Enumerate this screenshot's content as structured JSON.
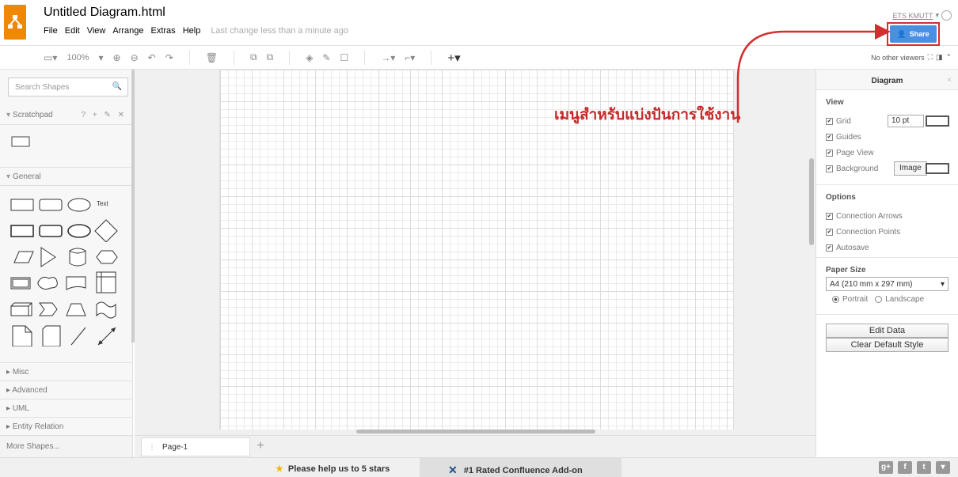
{
  "app": {
    "doc_title": "Untitled Diagram.html",
    "menu": [
      "File",
      "Edit",
      "View",
      "Arrange",
      "Extras",
      "Help"
    ],
    "last_change": "Last change less than a minute ago",
    "user_name": "ETS KMUTT",
    "share_label": "Share",
    "accent": "#4a90e2",
    "logo_color": "#f08705"
  },
  "toolbar": {
    "zoom": "100%",
    "viewers": "No other viewers"
  },
  "sidebar": {
    "search_placeholder": "Search Shapes",
    "scratchpad_label": "Scratchpad",
    "scratchpad_tools": "? + ✎ ✕",
    "general_label": "General",
    "text_shape": "Text",
    "sections": [
      "Misc",
      "Advanced",
      "UML",
      "Entity Relation"
    ],
    "more_shapes": "More Shapes..."
  },
  "pages": {
    "tab_label": "Page-1"
  },
  "annotation": {
    "text": "เมนูสำหรับแบ่งปันการใช้งาน",
    "color": "#c62828"
  },
  "panel": {
    "title": "Diagram",
    "view_title": "View",
    "grid_label": "Grid",
    "grid_size": "10 pt",
    "guides_label": "Guides",
    "page_view_label": "Page View",
    "background_label": "Background",
    "image_button": "Image",
    "options_title": "Options",
    "connection_arrows": "Connection Arrows",
    "connection_points": "Connection Points",
    "autosave": "Autosave",
    "paper_size_title": "Paper Size",
    "paper_size_value": "A4 (210 mm x 297 mm)",
    "portrait": "Portrait",
    "landscape": "Landscape",
    "edit_data": "Edit Data",
    "clear_style": "Clear Default Style"
  },
  "footer": {
    "promo_stars": "Please help us to 5 stars",
    "promo_confluence": "#1 Rated Confluence Add-on"
  }
}
